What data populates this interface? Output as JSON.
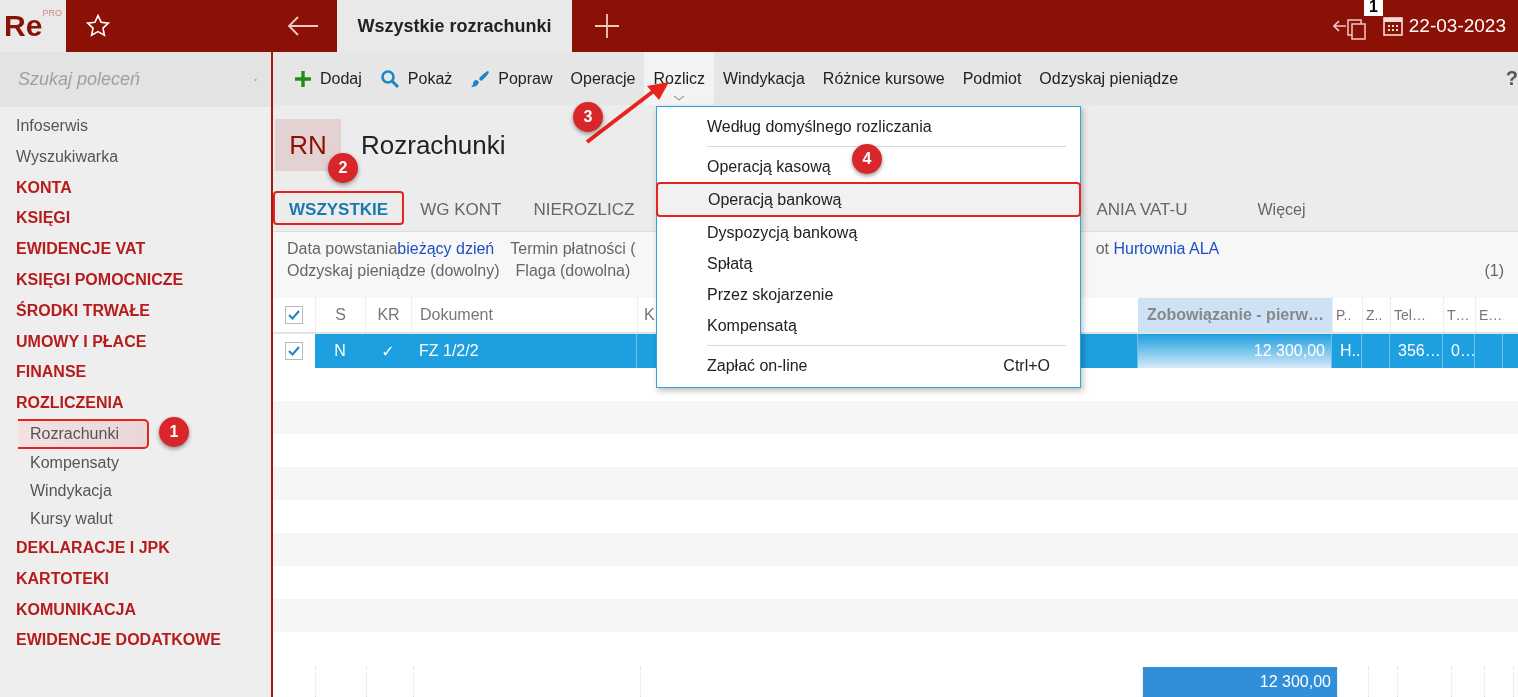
{
  "app": {
    "logo": "Re",
    "logo_sup": "PRO",
    "tab_title": "Wszystkie rozrachunki",
    "badge": "1",
    "date": "22-03-2023"
  },
  "sidebar": {
    "search_placeholder": "Szukaj poleceń",
    "items": [
      {
        "label": "Infoserwis",
        "kind": "link",
        "selected": false
      },
      {
        "label": "Wyszukiwarka",
        "kind": "link",
        "selected": false
      },
      {
        "label": "KONTA",
        "kind": "section",
        "selected": false
      },
      {
        "label": "KSIĘGI",
        "kind": "section",
        "selected": false
      },
      {
        "label": "EWIDENCJE VAT",
        "kind": "section",
        "selected": false
      },
      {
        "label": "KSIĘGI POMOCNICZE",
        "kind": "section",
        "selected": false
      },
      {
        "label": "ŚRODKI TRWAŁE",
        "kind": "section",
        "selected": false
      },
      {
        "label": "UMOWY I PŁACE",
        "kind": "section",
        "selected": false
      },
      {
        "label": "FINANSE",
        "kind": "section",
        "selected": false
      },
      {
        "label": "ROZLICZENIA",
        "kind": "section",
        "selected": false
      },
      {
        "label": "Rozrachunki",
        "kind": "sub",
        "selected": true
      },
      {
        "label": "Kompensaty",
        "kind": "sub",
        "selected": false
      },
      {
        "label": "Windykacja",
        "kind": "sub",
        "selected": false
      },
      {
        "label": "Kursy walut",
        "kind": "sub",
        "selected": false
      },
      {
        "label": "DEKLARACJE I JPK",
        "kind": "section",
        "selected": false
      },
      {
        "label": "KARTOTEKI",
        "kind": "section",
        "selected": false
      },
      {
        "label": "KOMUNIKACJA",
        "kind": "section",
        "selected": false
      },
      {
        "label": "EWIDENCJE DODATKOWE",
        "kind": "section",
        "selected": false
      }
    ]
  },
  "toolbar": {
    "items": [
      {
        "label": "Dodaj",
        "open": false
      },
      {
        "label": "Pokaż",
        "open": false
      },
      {
        "label": "Popraw",
        "open": false
      },
      {
        "label": "Operacje",
        "open": false
      },
      {
        "label": "Rozlicz",
        "open": true
      },
      {
        "label": "Windykacja",
        "open": false
      },
      {
        "label": "Różnice kursowe",
        "open": false
      },
      {
        "label": "Podmiot",
        "open": false
      },
      {
        "label": "Odzyskaj pieniądze",
        "open": false
      }
    ],
    "help": "?"
  },
  "header": {
    "badge": "RN",
    "title": "Rozrachunki"
  },
  "tabs": [
    {
      "label": "WSZYSTKIE",
      "selected": true
    },
    {
      "label": "WG KONT",
      "selected": false
    },
    {
      "label": "NIEROZLICZ",
      "selected": false
    },
    {
      "label": "ANIA VAT-U",
      "selected": false
    },
    {
      "label": "Więcej",
      "selected": false
    }
  ],
  "filters": {
    "line1": [
      {
        "label": "Data powstania",
        "value": "bieżący dzień"
      },
      {
        "label": "Termin płatności ("
      }
    ],
    "line1_right": {
      "label": "ot",
      "value": "Hurtownia ALA"
    },
    "line2": [
      "Odzyskaj pieniądze (dowolny)",
      "Flaga (dowolna)"
    ],
    "count": "(1)"
  },
  "table": {
    "columns": [
      {
        "label": "S",
        "highlighted": false
      },
      {
        "label": "KR",
        "highlighted": false
      },
      {
        "label": "Dokument",
        "highlighted": false
      },
      {
        "label": "K",
        "highlighted": false
      },
      {
        "label": "Zobowiązanie - pierw…",
        "highlighted": true
      },
      {
        "label": "P..",
        "highlighted": false
      },
      {
        "label": "Z..",
        "highlighted": false
      },
      {
        "label": "Tel…",
        "highlighted": false
      },
      {
        "label": "T…",
        "highlighted": false
      },
      {
        "label": "E…",
        "highlighted": false
      }
    ],
    "all_checked": true,
    "rows": [
      {
        "checked": true,
        "selected": true,
        "cells": [
          "N",
          "✓",
          "FZ 1/2/2",
          "",
          "12 300,00",
          "H..",
          "",
          "356…",
          "0…",
          ""
        ]
      }
    ],
    "total": "12 300,00"
  },
  "menu": {
    "items": [
      {
        "label": "Według domyślnego rozliczania",
        "selected": false,
        "separator_after": true
      },
      {
        "label": "Operacją kasową",
        "selected": false,
        "separator_after": false
      },
      {
        "label": "Operacją bankową",
        "selected": true,
        "separator_after": false
      },
      {
        "label": "Dyspozycją bankową",
        "selected": false,
        "separator_after": false
      },
      {
        "label": "Spłatą",
        "selected": false,
        "separator_after": false
      },
      {
        "label": "Przez skojarzenie",
        "selected": false,
        "separator_after": false
      },
      {
        "label": "Kompensatą",
        "selected": false,
        "separator_after": true
      },
      {
        "label": "Zapłać on-line",
        "selected": false,
        "separator_after": false,
        "shortcut": "Ctrl+O"
      }
    ]
  },
  "annotations": [
    "1",
    "2",
    "3",
    "4"
  ]
}
